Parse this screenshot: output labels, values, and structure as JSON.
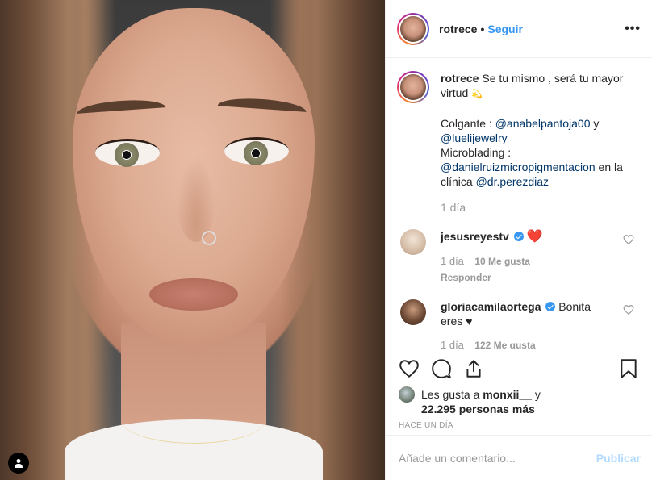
{
  "header": {
    "username": "rotrece",
    "separator": "•",
    "follow_label": "Seguir",
    "more_label": "•••"
  },
  "caption": {
    "username": "rotrece",
    "text": "Se tu mismo , será tu mayor virtud",
    "emoji": "💫",
    "line2_prefix": "Colgante : ",
    "mention1": "@anabelpantoja00",
    "and": " y",
    "mention2": "@luelijewelry",
    "line3": "Microblading :",
    "mention3": "@danielruizmicropigmentacion",
    "line3_mid": " en la clínica ",
    "mention4": "@dr.perezdiaz",
    "time": "1 día"
  },
  "comments": [
    {
      "username": "jesusreyestv",
      "text": "❤️",
      "time": "1 día",
      "likes": "10 Me gusta",
      "reply": "Responder"
    },
    {
      "username": "gloriacamilaortega",
      "text": "Bonita eres ♥",
      "time": "1 día",
      "likes": "122 Me gusta"
    }
  ],
  "likes": {
    "prefix": "Les gusta a ",
    "user": "monxii__",
    "suffix": " y",
    "count": "22.295 personas más"
  },
  "posted_ago": "HACE UN DÍA",
  "add_comment": {
    "placeholder": "Añade un comentario...",
    "publish_label": "Publicar"
  },
  "colors": {
    "link": "#3897f0",
    "mention": "#003569",
    "muted": "#999999",
    "publish_disabled": "#b3dbff",
    "heart": "#ed4956"
  },
  "icons": [
    "like-icon",
    "comment-icon",
    "share-icon",
    "save-icon",
    "user-tag-icon",
    "verified-badge-icon",
    "more-icon"
  ]
}
